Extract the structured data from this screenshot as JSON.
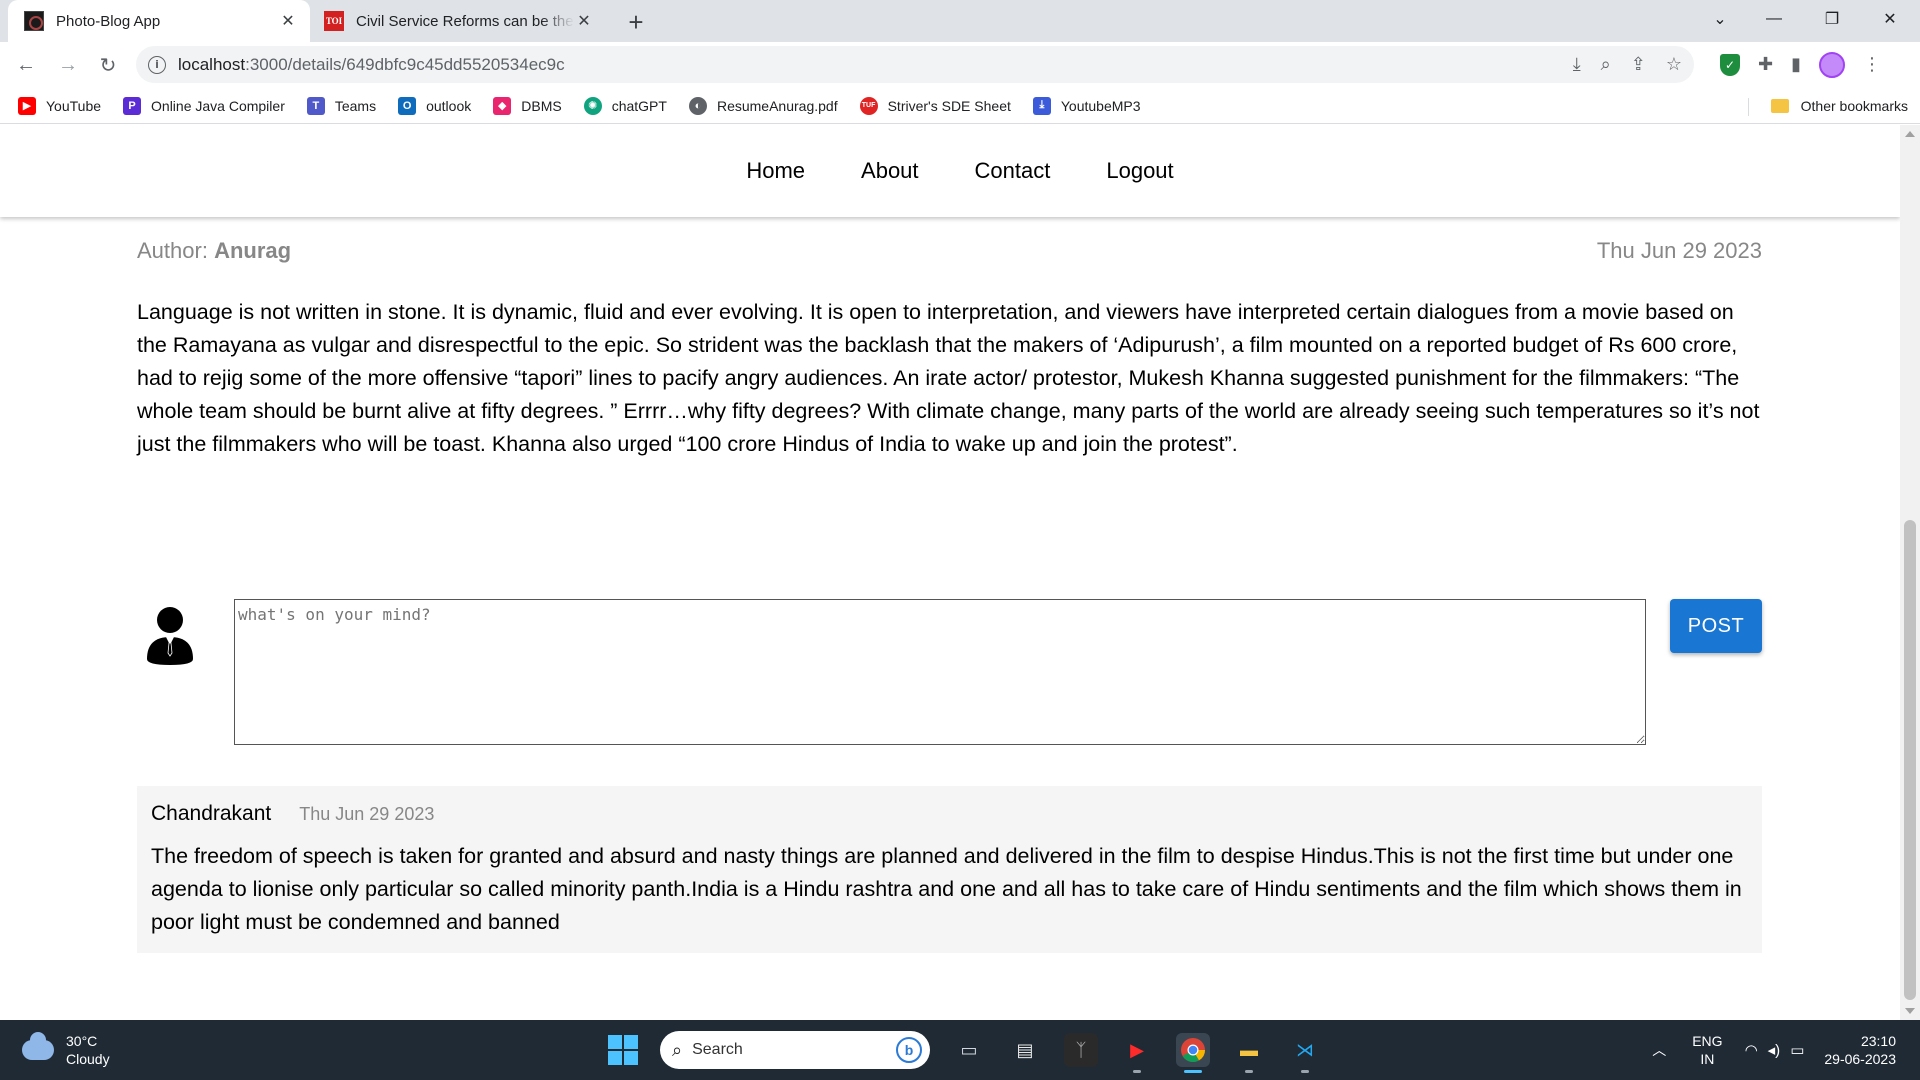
{
  "browser": {
    "tabs": [
      {
        "title": "Photo-Blog App",
        "favicon": "photo-blog-favicon",
        "active": true
      },
      {
        "title": "Civil Service Reforms can be the Key",
        "favicon": "toi-favicon",
        "active": false,
        "favicon_text": "TOI"
      }
    ],
    "url_host": "localhost",
    "url_rest": ":3000/details/649dbfc9c45dd5520534ec9c",
    "bookmarks": [
      {
        "label": "YouTube",
        "icon": "youtube-icon",
        "color": "#ff0000"
      },
      {
        "label": "Online Java Compiler",
        "icon": "java-compiler-icon",
        "color": "#5b2bd6"
      },
      {
        "label": "Teams",
        "icon": "teams-icon",
        "color": "#5059c9"
      },
      {
        "label": "outlook",
        "icon": "outlook-icon",
        "color": "#0f6cbd"
      },
      {
        "label": "DBMS",
        "icon": "dbms-icon",
        "color": "#e8256e"
      },
      {
        "label": "chatGPT",
        "icon": "chatgpt-icon",
        "color": "#10a37f"
      },
      {
        "label": "ResumeAnurag.pdf",
        "icon": "globe-icon",
        "color": "#5f6368"
      },
      {
        "label": "Striver's SDE Sheet",
        "icon": "striver-icon",
        "color": "#e02424"
      },
      {
        "label": "YoutubeMP3",
        "icon": "download-icon",
        "color": "#3b5bdb"
      }
    ],
    "other_bookmarks": "Other bookmarks"
  },
  "appbar": {
    "links": [
      "Home",
      "About",
      "Contact",
      "Logout"
    ]
  },
  "post": {
    "author_label": "Author:",
    "author": "Anurag",
    "date": "Thu Jun 29 2023",
    "body": "Language is not written in stone. It is dynamic, fluid and ever evolving. It is open to interpretation, and viewers have interpreted certain dialogues from a movie based on the Ramayana as vulgar and disrespectful to the epic. So strident was the backlash that the makers of ‘Adipurush’, a film mounted on a reported budget of Rs 600 crore, had to rejig some of the more offensive “tapori” lines to pacify angry audiences. An irate actor/ protestor, Mukesh Khanna suggested punishment for the filmmakers: “The whole team should be burnt alive at fifty degrees. ” Errrr…why fifty degrees? With climate change, many parts of the world are already seeing such temperatures so it’s not just the filmmakers who will be toast. Khanna also urged “100 crore Hindus of India to wake up and join the protest”."
  },
  "comment_form": {
    "placeholder": "what's on your mind?",
    "post_button": "POST"
  },
  "comments": [
    {
      "name": "Chandrakant",
      "date": "Thu Jun 29 2023",
      "text": "The freedom of speech is taken for granted and absurd and nasty things are planned and delivered in the film to despise Hindus.This is not the first time but under one agenda to lionise only particular so called minority panth.India is a Hindu rashtra and one and all has to take care of Hindu sentiments and the film which shows them in poor light must be condemned and banned"
    }
  ],
  "taskbar": {
    "weather_temp": "30°C",
    "weather_desc": "Cloudy",
    "search_label": "Search",
    "lang_top": "ENG",
    "lang_bottom": "IN",
    "time": "23:10",
    "date": "29-06-2023"
  },
  "colors": {
    "accent": "#1976d2",
    "taskbar": "#1f2a35",
    "comment_bg": "#f5f5f5"
  }
}
